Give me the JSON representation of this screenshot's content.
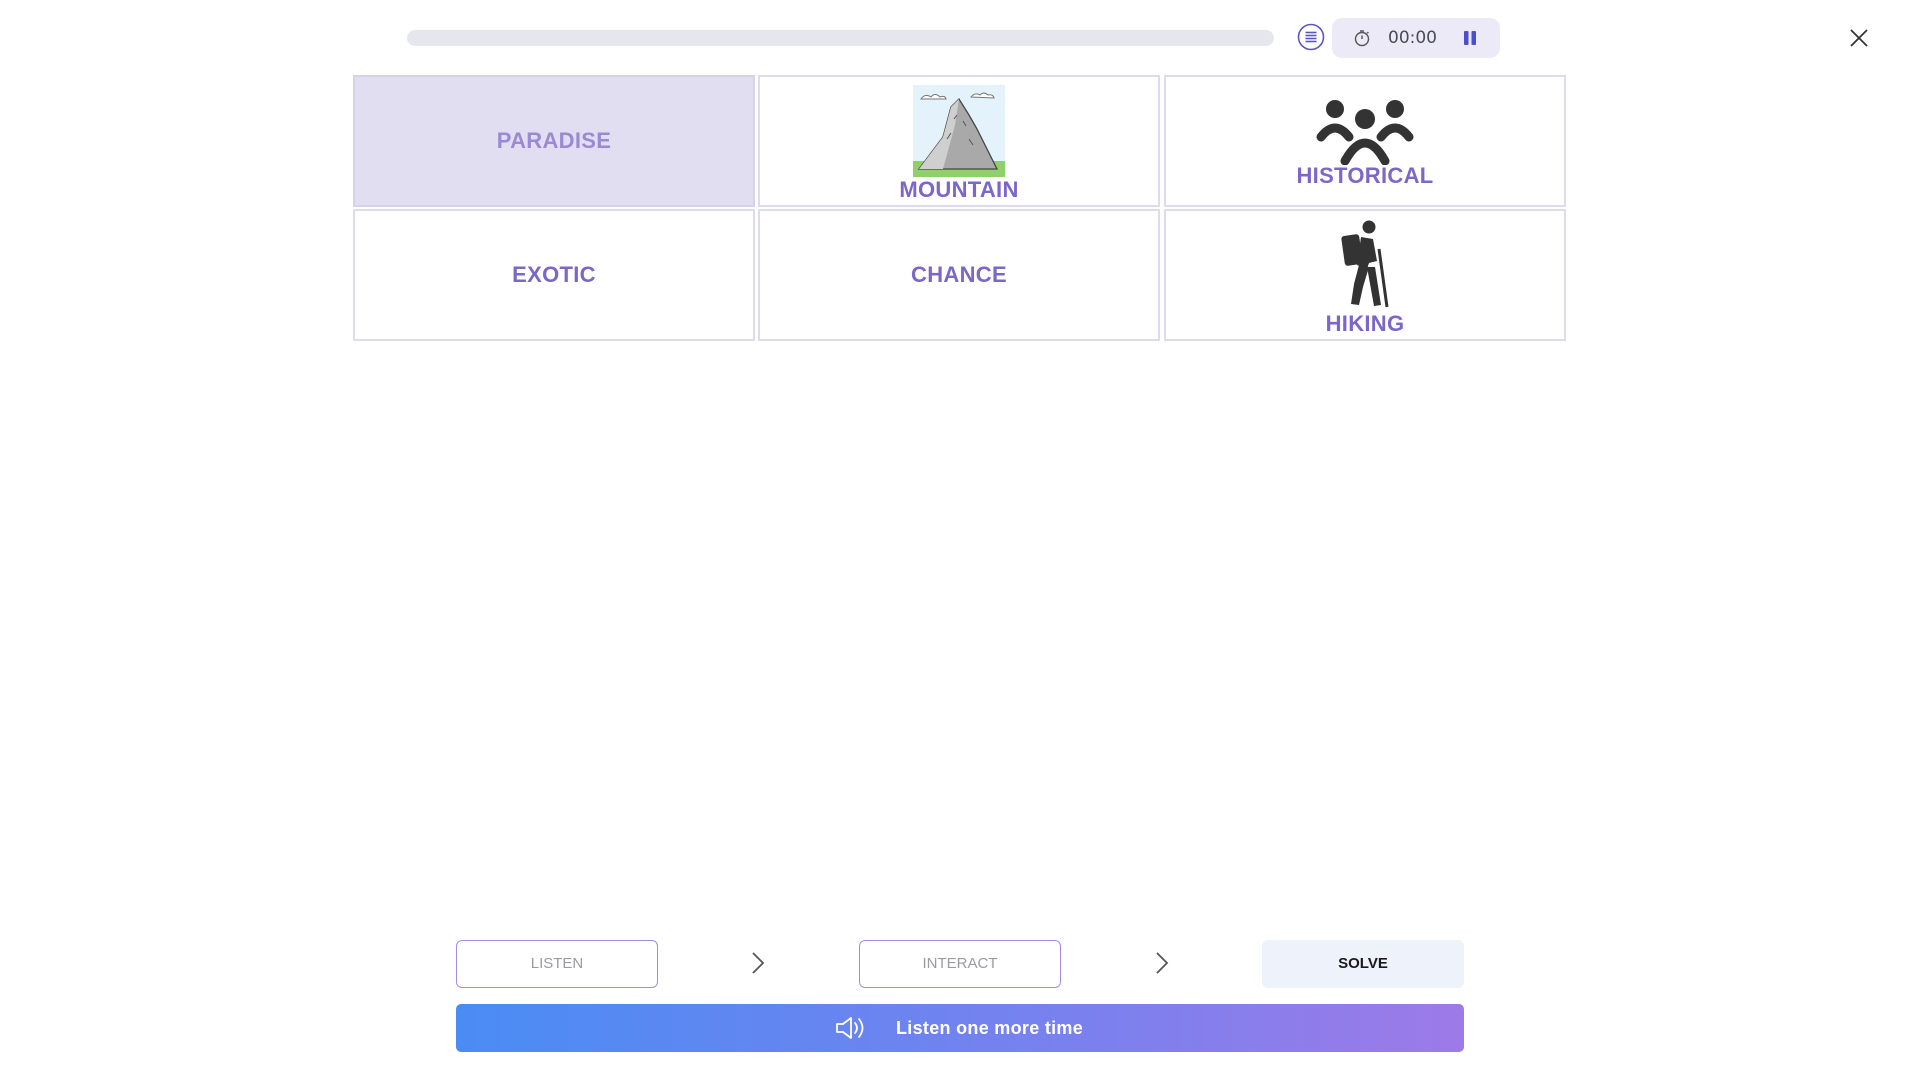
{
  "header": {
    "progress_percent": 0,
    "timer": "00:00"
  },
  "tiles": [
    {
      "word": "PARADISE",
      "selected": true,
      "image": null
    },
    {
      "word": "MOUNTAIN",
      "selected": false,
      "image": "mountain-picture"
    },
    {
      "word": "HISTORICAL",
      "selected": false,
      "image": "group-of-people-icon"
    },
    {
      "word": "EXOTIC",
      "selected": false,
      "image": null
    },
    {
      "word": "CHANCE",
      "selected": false,
      "image": null
    },
    {
      "word": "HIKING",
      "selected": false,
      "image": "hiker-icon"
    }
  ],
  "steps": {
    "listen": "LISTEN",
    "interact": "INTERACT",
    "solve": "SOLVE"
  },
  "listen_button": {
    "label": "Listen one more time",
    "icon": "speaker-icon"
  },
  "colors": {
    "word": "#7b67c8",
    "selected_tile": "#e2def2",
    "gradient_start": "#4a8cf4",
    "gradient_end": "#9d7ae8"
  }
}
